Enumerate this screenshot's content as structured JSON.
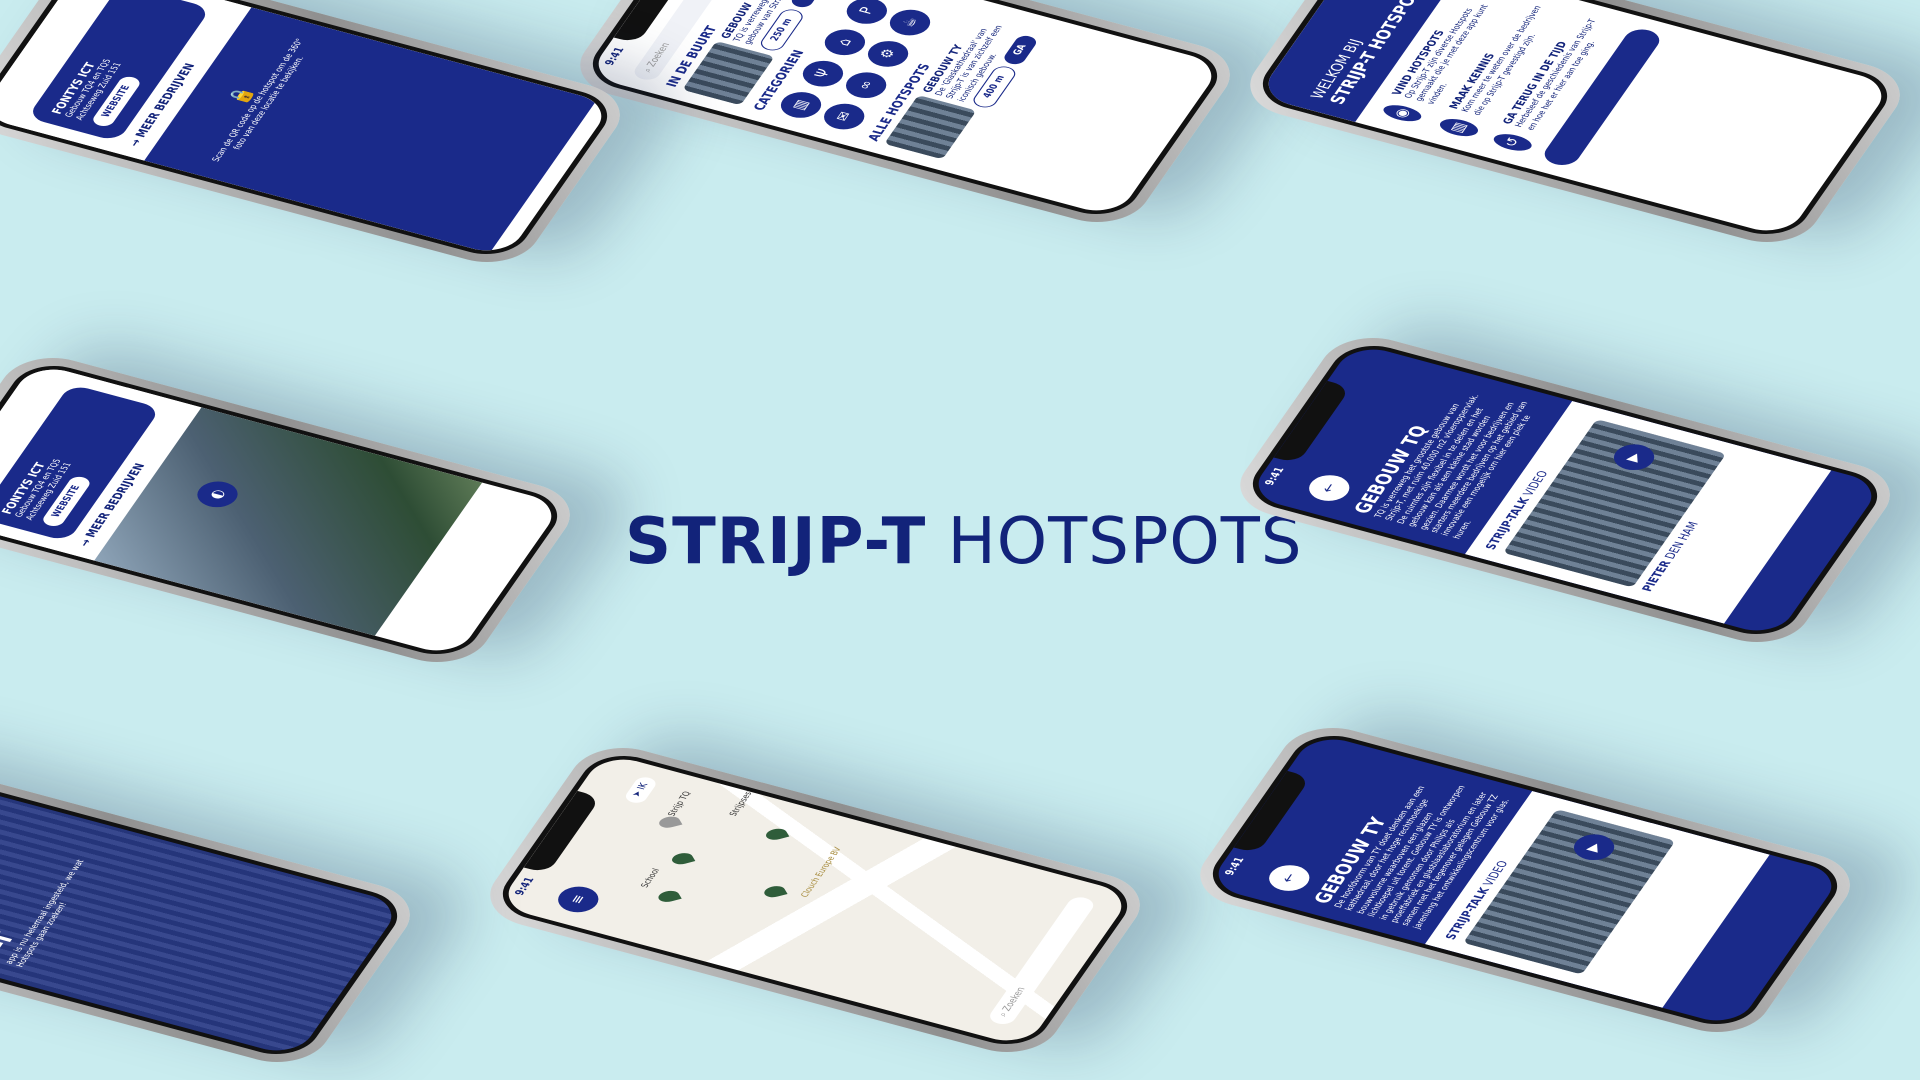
{
  "title": {
    "bold": "STRIJP-T",
    "light": "HOTSPOTS"
  },
  "status": {
    "time": "9:41"
  },
  "phone_home": {
    "search_placeholder": "Zoeken",
    "nearby_title": "IN DE BUURT",
    "nearby_item": {
      "name": "GEBOUW TQ",
      "desc": "TQ is verreweg het grootste gebouw van Strijp-T.",
      "distance": "250 m",
      "go": "GA"
    },
    "categories_title": "CATEGORIEN",
    "all_title": "ALLE HOTSPOTS",
    "all_item": {
      "name": "GEBOUW TY",
      "desc": "De 'Glaskathedraal' van Strijp-T is van zichzelf een iconisch gebouw.",
      "distance": "400 m",
      "go": "GA"
    }
  },
  "phone_company": {
    "company": "FONTYS ICT",
    "addr1": "Gebouw TQ4 en TQ5",
    "addr2": "Achtseweg Zuid 151",
    "website": "WEBSITE",
    "more": "MEER BEDRIJVEN",
    "lock_text": "Scan de QR code op de hotspot om de 360° foto van deze locatie te bekijken."
  },
  "phone_welcome": {
    "welcome": "WELKOM BIJ",
    "brand": "STRIJP-T HOTSPOTS",
    "items": [
      {
        "title": "VIND HOTSPOTS",
        "desc": "Op Strijp-T zijn diverse Hotspots gemaakt die je met deze app kunt vinden."
      },
      {
        "title": "MAAK KENNIS",
        "desc": "Kom meer te weten over de bedrijven die op Strijp-T gevestigd zijn."
      },
      {
        "title": "GA TERUG IN DE TIJD",
        "desc": "Herbeleef de geschiedenis van Strijp-T en hoe het er hier aan toe ging."
      }
    ]
  },
  "phone_tq": {
    "name": "GEBOUW TQ",
    "desc": "TQ is verreweg het grootste gebouw van Strijp-T, met ruim 40.000 m2 vloeroppervlak. De ruimtes zijn flexibel in te delen en het gebouw kan als een kleine stad worden gezien. Daarmee wordt het voor bedrijven en starters meerdere bedrijven op het gebied van innovatie een mogelijk om hier een plek te huren.",
    "video_bold": "STRIJP-TALK",
    "video_light": "VIDEO",
    "person_bold": "PIETER",
    "person_light": "DEN HAM"
  },
  "phone_ty": {
    "name": "GEBOUW TY",
    "desc": "De hoofdvorm van TY doet denken aan een kathedraal, door het hoge rechthoekige bouwvolume waarboven een glazen lichtkoepel uit torent. Gebouw TY is ontworpen in gebruik genomen door Philips als proeffabriek en glasblaaslaboratorium en later samen met het tegenover gelegen Gebouw TZ jarenlang het ontwikkelingscentrum voor glas.",
    "video_bold": "STRIJP-TALK",
    "video_light": "VIDEO"
  },
  "phone_map": {
    "me": "IK",
    "labels": [
      "Strijp TQ",
      "School",
      "Strijpsestraat",
      "Clouch Europe BV",
      "Zoeken"
    ]
  },
  "phone_intro": {
    "line1": "M OP",
    "line2": "P-T",
    "desc": "app is nu helemaal ingesteld, we wat Hotspots gaan zoeken!"
  }
}
